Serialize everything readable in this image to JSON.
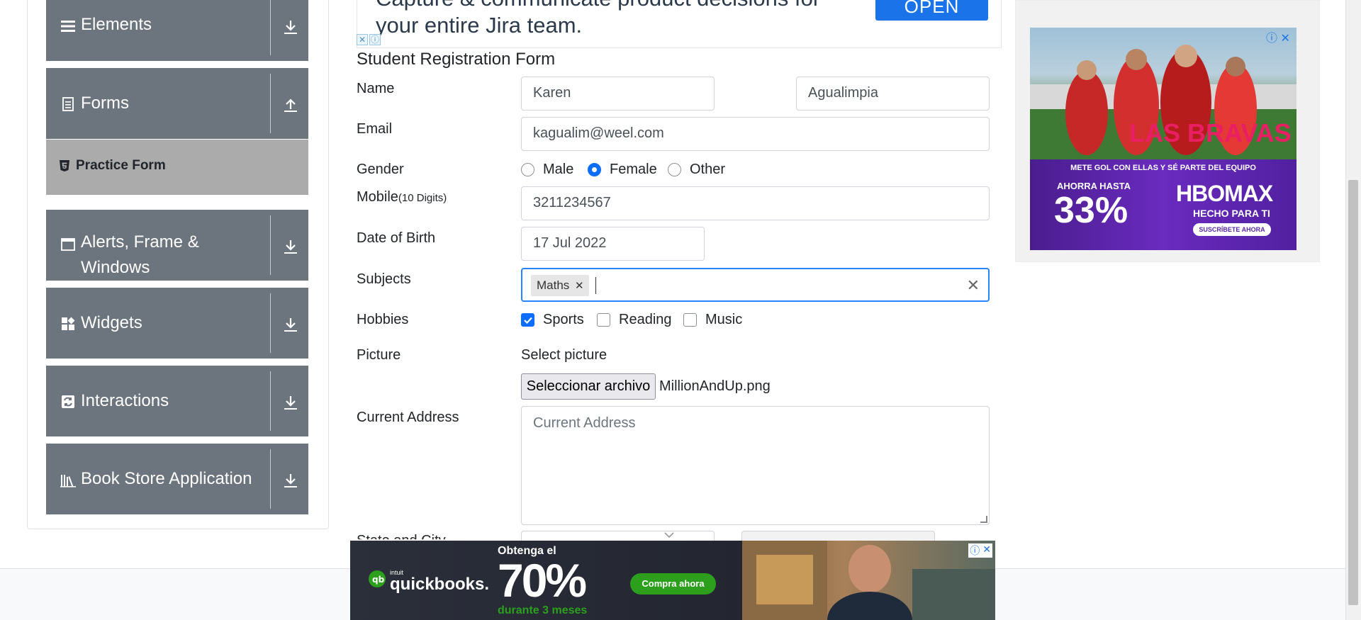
{
  "sidebar": {
    "groups": [
      {
        "label": "Elements",
        "icon": "list-icon",
        "arrow": "download-arrow-icon"
      },
      {
        "label": "Forms",
        "icon": "document-icon",
        "arrow": "upload-arrow-icon"
      },
      {
        "label": "Alerts, Frame &",
        "label2": "Windows",
        "icon": "window-icon",
        "arrow": "download-arrow-icon"
      },
      {
        "label": "Widgets",
        "icon": "widgets-icon",
        "arrow": "download-arrow-icon"
      },
      {
        "label": "Interactions",
        "icon": "interactions-icon",
        "arrow": "download-arrow-icon"
      },
      {
        "label": "Book Store Application",
        "icon": "books-icon",
        "arrow": "download-arrow-icon"
      }
    ],
    "active_item": {
      "label": "Practice Form",
      "icon": "html5-icon"
    }
  },
  "top_ad": {
    "text_line1": "Capture & communicate product decisions for",
    "text_line2": "your entire Jira team.",
    "button": "OPEN"
  },
  "form": {
    "title": "Student Registration Form",
    "labels": {
      "name": "Name",
      "email": "Email",
      "gender": "Gender",
      "mobile": "Mobile",
      "mobile_hint": "(10 Digits)",
      "dob": "Date of Birth",
      "subjects": "Subjects",
      "hobbies": "Hobbies",
      "picture": "Picture",
      "address": "Current Address",
      "state_city": "State and City"
    },
    "first_name": "Karen",
    "last_name": "Agualimpia",
    "email": "kagualim@weel.com",
    "gender_options": [
      "Male",
      "Female",
      "Other"
    ],
    "gender_selected": "Female",
    "mobile": "3211234567",
    "dob": "17 Jul 2022",
    "subjects": [
      "Maths"
    ],
    "hobbies": [
      {
        "label": "Sports",
        "checked": true
      },
      {
        "label": "Reading",
        "checked": false
      },
      {
        "label": "Music",
        "checked": false
      }
    ],
    "picture_caption": "Select picture",
    "file_button": "Seleccionar archivo",
    "file_name": "MillionAndUp.png",
    "address_placeholder": "Current Address"
  },
  "right_ad": {
    "tagline": "METE GOL CON ELLAS Y SÉ PARTE DEL EQUIPO",
    "discount_prefix": "AHORRA HASTA",
    "discount": "33%",
    "brand": "HBOMAX",
    "brand_sub": "HECHO PARA TI",
    "cta": "SUSCRÍBETE AHORA",
    "banner": "LAS BRAVAS"
  },
  "bottom_ad": {
    "brand_small": "intuit",
    "brand": "quickbooks.",
    "headline": "Obtenga el",
    "percent": "70%",
    "sub": "durante 3 meses",
    "cta": "Compra ahora"
  },
  "colors": {
    "sidebar_group": "#6c757d",
    "active_item": "#ababab",
    "primary": "#0d6efd",
    "focus_border": "#2684ff"
  }
}
